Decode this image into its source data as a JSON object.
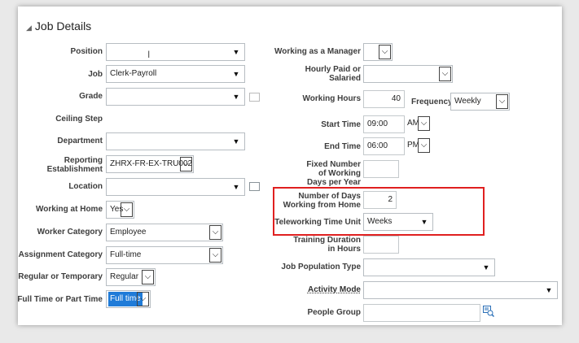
{
  "section": {
    "title": "Job Details"
  },
  "left": {
    "position": {
      "label": "Position",
      "value": ""
    },
    "job": {
      "label": "Job",
      "value": "Clerk-Payroll"
    },
    "grade": {
      "label": "Grade",
      "value": ""
    },
    "ceiling_step": {
      "label": "Ceiling Step"
    },
    "department": {
      "label": "Department",
      "value": ""
    },
    "reporting_establishment": {
      "label": "Reporting Establishment",
      "value": "ZHRX-FR-EX-TRU002"
    },
    "location": {
      "label": "Location",
      "value": ""
    },
    "working_at_home": {
      "label": "Working at Home",
      "value": "Yes"
    },
    "worker_category": {
      "label": "Worker Category",
      "value": "Employee"
    },
    "assignment_category": {
      "label": "Assignment Category",
      "value": "Full-time"
    },
    "regular_or_temporary": {
      "label": "Regular or Temporary",
      "value": "Regular"
    },
    "full_or_part_time": {
      "label": "Full Time or Part Time",
      "value": "Full time"
    }
  },
  "right": {
    "working_as_manager": {
      "label": "Working as a Manager",
      "value": ""
    },
    "hourly_paid": {
      "label": "Hourly Paid or Salaried",
      "value": ""
    },
    "working_hours": {
      "label": "Working Hours",
      "value": "40"
    },
    "frequency": {
      "label": "Frequency",
      "value": "Weekly"
    },
    "start_time": {
      "label": "Start Time",
      "value": "09:00",
      "ampm": "AM"
    },
    "end_time": {
      "label": "End Time",
      "value": "06:00",
      "ampm": "PM"
    },
    "fixed_days": {
      "label": "Fixed Number of Working Days per Year",
      "value": ""
    },
    "days_from_home": {
      "label": "Number of Days Working from Home",
      "value": "2"
    },
    "teleworking_unit": {
      "label": "Teleworking Time Unit",
      "value": "Weeks"
    },
    "training_duration": {
      "label": "Training Duration in Hours",
      "value": ""
    },
    "job_population_type": {
      "label": "Job Population Type",
      "value": ""
    },
    "activity_mode": {
      "label": "Activity Mode",
      "value": ""
    },
    "people_group": {
      "label": "People Group",
      "value": ""
    }
  },
  "icons": {
    "dropdown": "▼",
    "check_dropdown": "⌵",
    "lov": "search-list-icon"
  },
  "colors": {
    "highlight": "#e02020",
    "selected": "#1f7bd8"
  }
}
